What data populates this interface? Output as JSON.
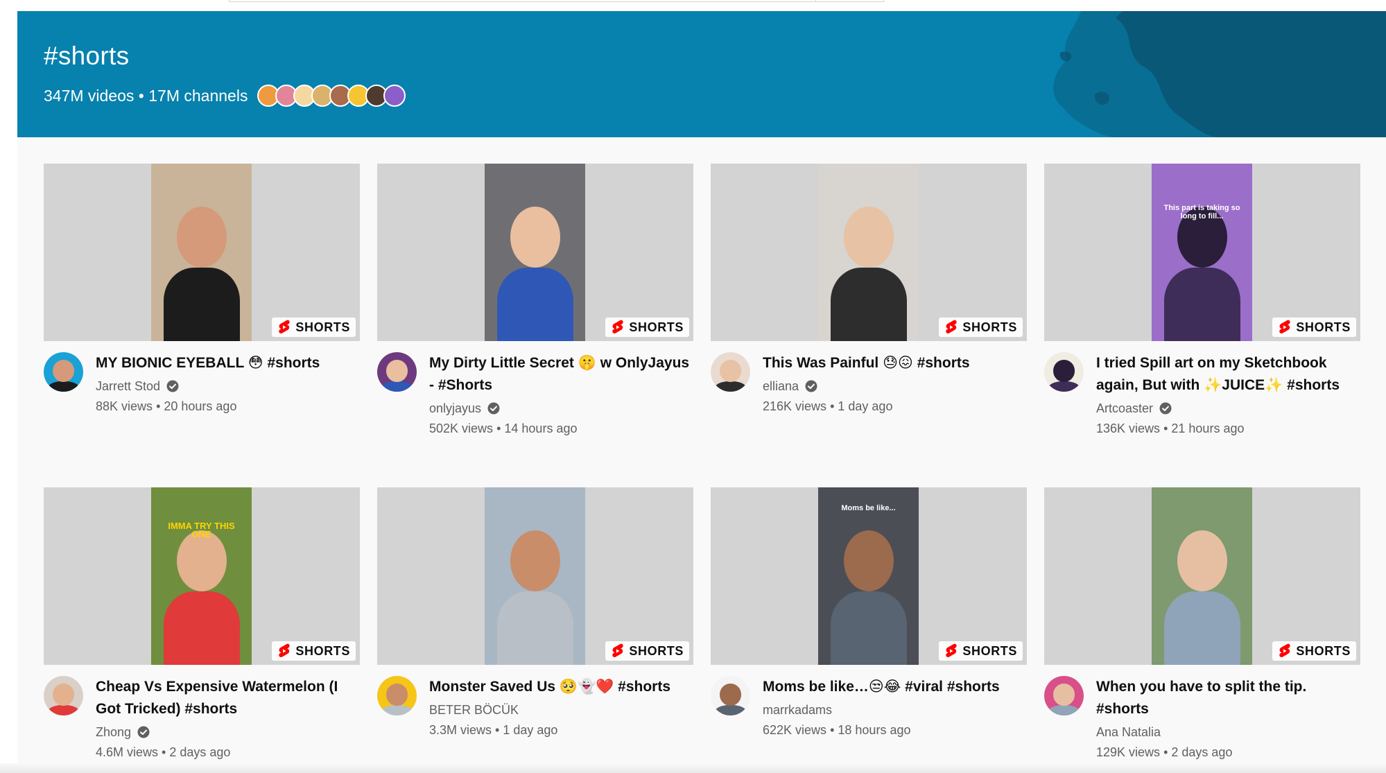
{
  "hashtag": {
    "title": "#shorts",
    "stats": "347M videos • 17M channels",
    "banner_color": "#0781ad",
    "channel_avatars": [
      "#ef9a3f",
      "#e0859a",
      "#f5d8a0",
      "#d9b26b",
      "#a86b4c",
      "#f6c532",
      "#4e3a2e",
      "#8a5fc9"
    ]
  },
  "badge_label": "SHORTS",
  "videos": [
    {
      "title": "MY BIONIC EYEBALL 😳 #shorts",
      "channel": "Jarrett Stod",
      "verified": true,
      "views": "88K views",
      "age": "20 hours ago",
      "thumb_bg": "#c9b49a",
      "figure_skin": "#d49a79",
      "figure_shirt": "#1c1c1c",
      "avatar_bg": "#1aa1d6",
      "avatar_icon": "cartoon-man-avatar"
    },
    {
      "title": "My Dirty Little Secret 🤫 w OnlyJayus - #Shorts",
      "channel": "onlyjayus",
      "verified": true,
      "views": "502K views",
      "age": "14 hours ago",
      "thumb_bg": "#6f6f73",
      "figure_skin": "#e9bf9f",
      "figure_shirt": "#2f58b6",
      "avatar_bg": "#6d3a7f",
      "avatar_icon": "cartoon-girl-avatar"
    },
    {
      "title": "This Was Painful 😓😖 #shorts",
      "channel": "elliana",
      "verified": true,
      "views": "216K views",
      "age": "1 day ago",
      "thumb_bg": "#d8d4cf",
      "figure_skin": "#e7c2a4",
      "figure_shirt": "#2d2d2d",
      "avatar_bg": "#eadbd1",
      "avatar_icon": "blonde-woman-avatar"
    },
    {
      "title": "I tried Spill art on my Sketchbook again, But with ✨JUICE✨ #shorts",
      "channel": "Artcoaster",
      "verified": true,
      "views": "136K views",
      "age": "21 hours ago",
      "thumb_bg": "#9b6ec9",
      "figure_skin": "#2a1e3a",
      "figure_shirt": "#3e2d58",
      "overlay_text": "This part is taking so long to fill...",
      "avatar_bg": "#f1ece2",
      "avatar_icon": "pineapple-avatar"
    },
    {
      "title": "Cheap Vs Expensive Watermelon (I Got Tricked) #shorts",
      "channel": "Zhong",
      "verified": true,
      "views": "4.6M views",
      "age": "2 days ago",
      "thumb_bg": "#6f8f3e",
      "figure_skin": "#e3b18e",
      "figure_shirt": "#e03a3a",
      "overlay_text": "IMMA TRY THIS ONE",
      "avatar_bg": "#d9d0c8",
      "avatar_icon": "man-face-avatar"
    },
    {
      "title": "Monster Saved Us 🥺👻❤️ #shorts",
      "channel": "BETER BÖCÜK",
      "verified": false,
      "views": "3.3M views",
      "age": "1 day ago",
      "thumb_bg": "#a9b7c4",
      "figure_skin": "#c98d6a",
      "figure_shirt": "#b9bfc6",
      "avatar_bg": "#f5c518",
      "avatar_icon": "bug-cartoon-avatar"
    },
    {
      "title": "Moms be like…😒😂 #viral #shorts",
      "channel": "marrkadams",
      "verified": false,
      "views": "622K views",
      "age": "18 hours ago",
      "thumb_bg": "#4b4e55",
      "figure_skin": "#9c6a4c",
      "figure_shirt": "#596473",
      "overlay_text": "Moms be like...",
      "avatar_bg": "#f4f4f4",
      "avatar_icon": "man-standing-avatar"
    },
    {
      "title": "When you have to split the tip. #shorts",
      "channel": "Ana Natalia",
      "verified": false,
      "views": "129K views",
      "age": "2 days ago",
      "thumb_bg": "#7e9a6e",
      "figure_skin": "#e6bfa3",
      "figure_shirt": "#8fa4b8",
      "avatar_bg": "#d94f8a",
      "avatar_icon": "woman-face-avatar"
    }
  ]
}
